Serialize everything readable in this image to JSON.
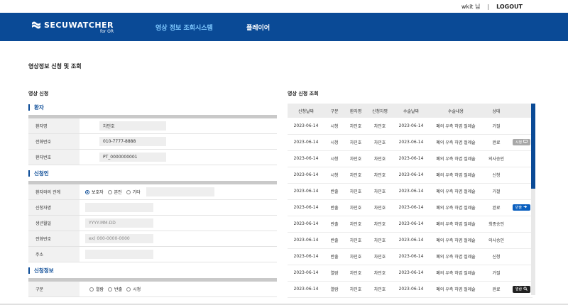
{
  "topbar": {
    "user": "wkit 님",
    "sep": "|",
    "logout": "LOGOUT"
  },
  "nav": {
    "logo": "SECUWATCHER",
    "logo_sub": "for OR",
    "menu": [
      "영상 정보 조회시스템",
      "플레이어"
    ],
    "active_color": "#7ec8ff",
    "bg_color": "#0a4a96"
  },
  "page_title": "영상정보 신청 및 조회",
  "left": {
    "title": "영상 신청",
    "patient": {
      "head": "환자",
      "rows": [
        {
          "label": "환자명",
          "value": "차민호"
        },
        {
          "label": "전화번호",
          "value": "010-7777-8888"
        },
        {
          "label": "환자번호",
          "value": "PT_0000000001"
        }
      ]
    },
    "applicant": {
      "head": "신청인",
      "relation_label": "환자와의 관계",
      "relation_options": [
        "보호자",
        "본인",
        "기타"
      ],
      "relation_selected": "보호자",
      "name_label": "신청자명",
      "birth_label": "생년월일",
      "birth_placeholder": "YYYY-MM-DD",
      "phone_label": "전화번호",
      "phone_placeholder": "ex) 000-0000-0000",
      "address_label": "주소"
    },
    "request": {
      "head": "신청정보",
      "type_label": "구분",
      "type_options": [
        "열람",
        "반출",
        "시청"
      ]
    }
  },
  "right": {
    "title": "영상 신청 조회",
    "columns": [
      "신청날짜",
      "구분",
      "환자명",
      "신청자명",
      "수술날짜",
      "수술내용",
      "상태",
      ""
    ],
    "rows": [
      [
        "2023-06-14",
        "시청",
        "차민호",
        "차민호",
        "2023-06-14",
        "폐의 우측 하엽 절제술",
        "거절",
        ""
      ],
      [
        "2023-06-14",
        "시청",
        "차민호",
        "차민호",
        "2023-06-14",
        "폐의 우측 하엽 절제술",
        "완료",
        "시청"
      ],
      [
        "2023-06-14",
        "시청",
        "차민호",
        "차민호",
        "2023-06-14",
        "폐의 우측 하엽 절제술",
        "의사승인",
        ""
      ],
      [
        "2023-06-14",
        "시청",
        "차민호",
        "차민호",
        "2023-06-14",
        "폐의 우측 하엽 절제술",
        "신청",
        ""
      ],
      [
        "2023-06-14",
        "반출",
        "차민호",
        "차민호",
        "2023-06-14",
        "폐의 우측 하엽 절제술",
        "거절",
        ""
      ],
      [
        "2023-06-14",
        "반출",
        "차민호",
        "차민호",
        "2023-06-14",
        "폐의 우측 하엽 절제술",
        "완료",
        "반출"
      ],
      [
        "2023-06-14",
        "반출",
        "차민호",
        "차민호",
        "2023-06-14",
        "폐의 우측 하엽 절제술",
        "최종승인",
        ""
      ],
      [
        "2023-06-14",
        "반출",
        "차민호",
        "차민호",
        "2023-06-14",
        "폐의 우측 하엽 절제술",
        "의사승인",
        ""
      ],
      [
        "2023-06-14",
        "반출",
        "차민호",
        "차민호",
        "2023-06-14",
        "폐의 우측 하엽 절제술",
        "신청",
        ""
      ],
      [
        "2023-06-14",
        "열람",
        "차민호",
        "차민호",
        "2023-06-14",
        "폐의 우측 하엽 절제술",
        "거절",
        ""
      ],
      [
        "2023-06-14",
        "열람",
        "차민호",
        "차민호",
        "2023-06-14",
        "폐의 우측 하엽 절제술",
        "완료",
        "열람"
      ]
    ],
    "action_icons": {
      "시청": "monitor-icon",
      "반출": "export-icon",
      "열람": "magnifier-icon"
    }
  }
}
